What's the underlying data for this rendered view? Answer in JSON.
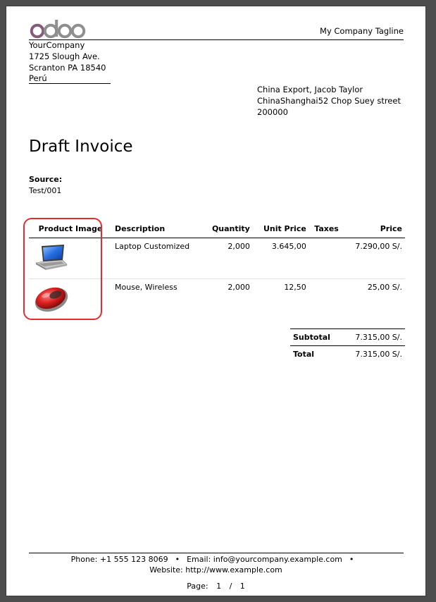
{
  "header": {
    "logo_text": "odoo",
    "tagline": "My Company Tagline"
  },
  "company": {
    "name": "YourCompany",
    "street": "1725 Slough Ave.",
    "city": "Scranton PA 18540",
    "country": "Perú"
  },
  "customer": {
    "line1": "China Export, Jacob Taylor",
    "line2": "ChinaShanghai52 Chop Suey street",
    "line3": "200000"
  },
  "invoice": {
    "title": "Draft Invoice",
    "source_label": "Source:",
    "source_value": "Test/001"
  },
  "table": {
    "headers": {
      "image": "Product Image",
      "description": "Description",
      "quantity": "Quantity",
      "unit_price": "Unit Price",
      "taxes": "Taxes",
      "price": "Price"
    },
    "rows": [
      {
        "image_icon": "laptop-icon",
        "description": "Laptop Customized",
        "quantity": "2,000",
        "unit_price": "3.645,00",
        "taxes": "",
        "price": "7.290,00 S/."
      },
      {
        "image_icon": "mouse-icon",
        "description": "Mouse, Wireless",
        "quantity": "2,000",
        "unit_price": "12,50",
        "taxes": "",
        "price": "25,00 S/."
      }
    ]
  },
  "totals": {
    "subtotal_label": "Subtotal",
    "subtotal_value": "7.315,00 S/.",
    "total_label": "Total",
    "total_value": "7.315,00 S/."
  },
  "footer": {
    "phone": "Phone: +1 555 123 8069",
    "email": "Email: info@yourcompany.example.com",
    "bullet": "•",
    "website": "Website: http://www.example.com",
    "page_label": "Page:",
    "page_current": "1",
    "page_sep": "/",
    "page_total": "1"
  },
  "colors": {
    "highlight": "#e52b2b",
    "logo_o": "#875a7b",
    "logo_doo": "#8f8f8f"
  }
}
